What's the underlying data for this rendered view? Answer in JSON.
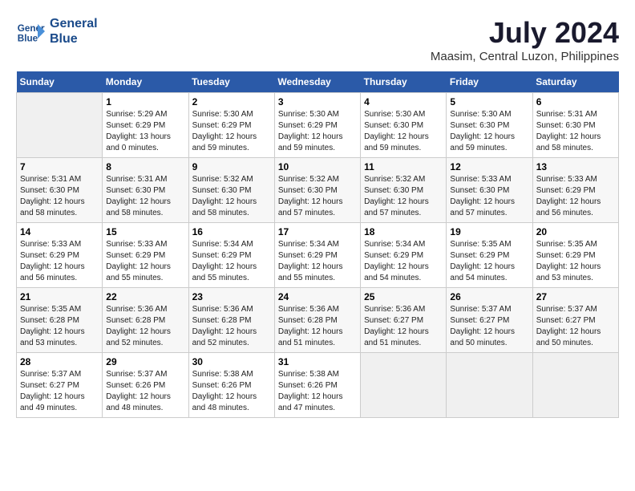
{
  "header": {
    "logo_line1": "General",
    "logo_line2": "Blue",
    "month": "July 2024",
    "location": "Maasim, Central Luzon, Philippines"
  },
  "weekdays": [
    "Sunday",
    "Monday",
    "Tuesday",
    "Wednesday",
    "Thursday",
    "Friday",
    "Saturday"
  ],
  "weeks": [
    [
      {
        "day": "",
        "info": ""
      },
      {
        "day": "1",
        "info": "Sunrise: 5:29 AM\nSunset: 6:29 PM\nDaylight: 13 hours\nand 0 minutes."
      },
      {
        "day": "2",
        "info": "Sunrise: 5:30 AM\nSunset: 6:29 PM\nDaylight: 12 hours\nand 59 minutes."
      },
      {
        "day": "3",
        "info": "Sunrise: 5:30 AM\nSunset: 6:29 PM\nDaylight: 12 hours\nand 59 minutes."
      },
      {
        "day": "4",
        "info": "Sunrise: 5:30 AM\nSunset: 6:30 PM\nDaylight: 12 hours\nand 59 minutes."
      },
      {
        "day": "5",
        "info": "Sunrise: 5:30 AM\nSunset: 6:30 PM\nDaylight: 12 hours\nand 59 minutes."
      },
      {
        "day": "6",
        "info": "Sunrise: 5:31 AM\nSunset: 6:30 PM\nDaylight: 12 hours\nand 58 minutes."
      }
    ],
    [
      {
        "day": "7",
        "info": "Sunrise: 5:31 AM\nSunset: 6:30 PM\nDaylight: 12 hours\nand 58 minutes."
      },
      {
        "day": "8",
        "info": "Sunrise: 5:31 AM\nSunset: 6:30 PM\nDaylight: 12 hours\nand 58 minutes."
      },
      {
        "day": "9",
        "info": "Sunrise: 5:32 AM\nSunset: 6:30 PM\nDaylight: 12 hours\nand 58 minutes."
      },
      {
        "day": "10",
        "info": "Sunrise: 5:32 AM\nSunset: 6:30 PM\nDaylight: 12 hours\nand 57 minutes."
      },
      {
        "day": "11",
        "info": "Sunrise: 5:32 AM\nSunset: 6:30 PM\nDaylight: 12 hours\nand 57 minutes."
      },
      {
        "day": "12",
        "info": "Sunrise: 5:33 AM\nSunset: 6:30 PM\nDaylight: 12 hours\nand 57 minutes."
      },
      {
        "day": "13",
        "info": "Sunrise: 5:33 AM\nSunset: 6:29 PM\nDaylight: 12 hours\nand 56 minutes."
      }
    ],
    [
      {
        "day": "14",
        "info": "Sunrise: 5:33 AM\nSunset: 6:29 PM\nDaylight: 12 hours\nand 56 minutes."
      },
      {
        "day": "15",
        "info": "Sunrise: 5:33 AM\nSunset: 6:29 PM\nDaylight: 12 hours\nand 55 minutes."
      },
      {
        "day": "16",
        "info": "Sunrise: 5:34 AM\nSunset: 6:29 PM\nDaylight: 12 hours\nand 55 minutes."
      },
      {
        "day": "17",
        "info": "Sunrise: 5:34 AM\nSunset: 6:29 PM\nDaylight: 12 hours\nand 55 minutes."
      },
      {
        "day": "18",
        "info": "Sunrise: 5:34 AM\nSunset: 6:29 PM\nDaylight: 12 hours\nand 54 minutes."
      },
      {
        "day": "19",
        "info": "Sunrise: 5:35 AM\nSunset: 6:29 PM\nDaylight: 12 hours\nand 54 minutes."
      },
      {
        "day": "20",
        "info": "Sunrise: 5:35 AM\nSunset: 6:29 PM\nDaylight: 12 hours\nand 53 minutes."
      }
    ],
    [
      {
        "day": "21",
        "info": "Sunrise: 5:35 AM\nSunset: 6:28 PM\nDaylight: 12 hours\nand 53 minutes."
      },
      {
        "day": "22",
        "info": "Sunrise: 5:36 AM\nSunset: 6:28 PM\nDaylight: 12 hours\nand 52 minutes."
      },
      {
        "day": "23",
        "info": "Sunrise: 5:36 AM\nSunset: 6:28 PM\nDaylight: 12 hours\nand 52 minutes."
      },
      {
        "day": "24",
        "info": "Sunrise: 5:36 AM\nSunset: 6:28 PM\nDaylight: 12 hours\nand 51 minutes."
      },
      {
        "day": "25",
        "info": "Sunrise: 5:36 AM\nSunset: 6:27 PM\nDaylight: 12 hours\nand 51 minutes."
      },
      {
        "day": "26",
        "info": "Sunrise: 5:37 AM\nSunset: 6:27 PM\nDaylight: 12 hours\nand 50 minutes."
      },
      {
        "day": "27",
        "info": "Sunrise: 5:37 AM\nSunset: 6:27 PM\nDaylight: 12 hours\nand 50 minutes."
      }
    ],
    [
      {
        "day": "28",
        "info": "Sunrise: 5:37 AM\nSunset: 6:27 PM\nDaylight: 12 hours\nand 49 minutes."
      },
      {
        "day": "29",
        "info": "Sunrise: 5:37 AM\nSunset: 6:26 PM\nDaylight: 12 hours\nand 48 minutes."
      },
      {
        "day": "30",
        "info": "Sunrise: 5:38 AM\nSunset: 6:26 PM\nDaylight: 12 hours\nand 48 minutes."
      },
      {
        "day": "31",
        "info": "Sunrise: 5:38 AM\nSunset: 6:26 PM\nDaylight: 12 hours\nand 47 minutes."
      },
      {
        "day": "",
        "info": ""
      },
      {
        "day": "",
        "info": ""
      },
      {
        "day": "",
        "info": ""
      }
    ]
  ]
}
